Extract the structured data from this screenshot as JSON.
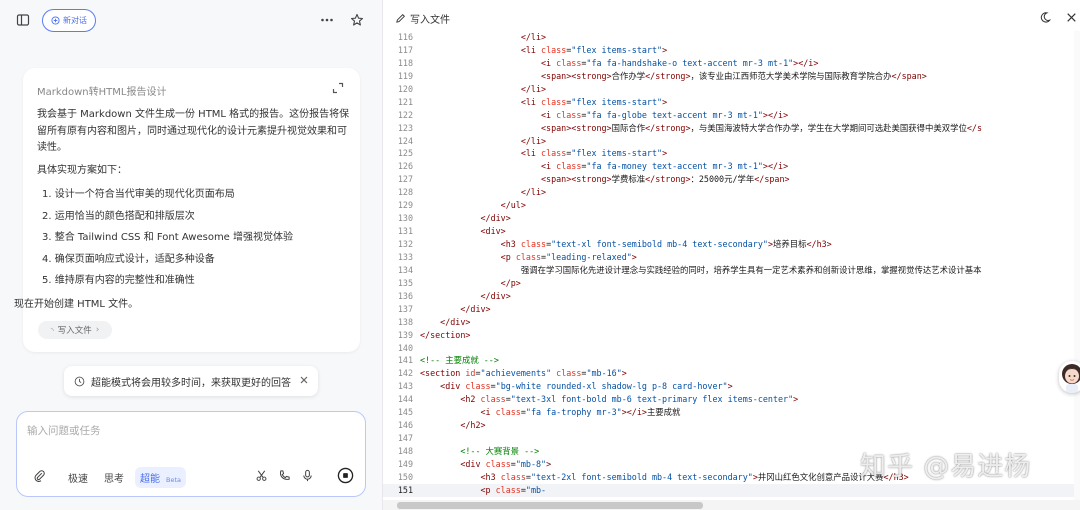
{
  "left": {
    "new_chat_label": "新对话",
    "card": {
      "title": "Markdown转HTML报告设计",
      "intro": "我会基于 Markdown 文件生成一份 HTML 格式的报告。这份报告将保留所有原有内容和图片，同时通过现代化的设计元素提升视觉效果和可读性。",
      "sub": "具体实现方案如下：",
      "steps": [
        "1. 设计一个符合当代审美的现代化页面布局",
        "2. 运用恰当的颜色搭配和排版层次",
        "3. 整合 Tailwind CSS 和 Font Awesome 增强视觉体验",
        "4. 确保页面响应式设计，适配多种设备",
        "5. 维持原有内容的完整性和准确性"
      ],
      "outro": "现在开始创建 HTML 文件。",
      "chip": "写入文件"
    },
    "notice": "超能模式将会用较多时间，来获取更好的回答",
    "input": {
      "placeholder": "输入问题或任务",
      "modes": [
        "极速",
        "思考",
        "超能"
      ],
      "beta": "Beta"
    }
  },
  "editor": {
    "title": "写入文件",
    "current_line": 151,
    "lines": [
      {
        "n": 116,
        "html": "<span class=\"t-tag\">                    &lt;/li&gt;</span>"
      },
      {
        "n": 117,
        "html": "<span class=\"t-tag\">                    &lt;li</span> <span class=\"t-attr\">class</span>=<span class=\"t-val\">\"flex items-start\"</span><span class=\"t-tag\">&gt;</span>"
      },
      {
        "n": 118,
        "html": "<span class=\"t-tag\">                        &lt;i</span> <span class=\"t-attr\">class</span>=<span class=\"t-val\">\"fa fa-handshake-o text-accent mr-3 mt-1\"</span><span class=\"t-tag\">&gt;&lt;/i&gt;</span>"
      },
      {
        "n": 119,
        "html": "<span class=\"t-tag\">                        &lt;span&gt;&lt;strong&gt;</span>合作办学<span class=\"t-tag\">&lt;/strong&gt;</span>，该专业由江西师范大学美术学院与国际教育学院合办<span class=\"t-tag\">&lt;/span&gt;</span>"
      },
      {
        "n": 120,
        "html": "<span class=\"t-tag\">                    &lt;/li&gt;</span>"
      },
      {
        "n": 121,
        "html": "<span class=\"t-tag\">                    &lt;li</span> <span class=\"t-attr\">class</span>=<span class=\"t-val\">\"flex items-start\"</span><span class=\"t-tag\">&gt;</span>"
      },
      {
        "n": 122,
        "html": "<span class=\"t-tag\">                        &lt;i</span> <span class=\"t-attr\">class</span>=<span class=\"t-val\">\"fa fa-globe text-accent mr-3 mt-1\"</span><span class=\"t-tag\">&gt;&lt;/i&gt;</span>"
      },
      {
        "n": 123,
        "html": "<span class=\"t-tag\">                        &lt;span&gt;&lt;strong&gt;</span>国际合作<span class=\"t-tag\">&lt;/strong&gt;</span>，与美国海波特大学合作办学，学生在大学期间可选赴美国获得中美双学位<span class=\"t-tag\">&lt;/s</span>"
      },
      {
        "n": 124,
        "html": "<span class=\"t-tag\">                    &lt;/li&gt;</span>"
      },
      {
        "n": 125,
        "html": "<span class=\"t-tag\">                    &lt;li</span> <span class=\"t-attr\">class</span>=<span class=\"t-val\">\"flex items-start\"</span><span class=\"t-tag\">&gt;</span>"
      },
      {
        "n": 126,
        "html": "<span class=\"t-tag\">                        &lt;i</span> <span class=\"t-attr\">class</span>=<span class=\"t-val\">\"fa fa-money text-accent mr-3 mt-1\"</span><span class=\"t-tag\">&gt;&lt;/i&gt;</span>"
      },
      {
        "n": 127,
        "html": "<span class=\"t-tag\">                        &lt;span&gt;&lt;strong&gt;</span>学费标准<span class=\"t-tag\">&lt;/strong&gt;</span>：25000元/学年<span class=\"t-tag\">&lt;/span&gt;</span>"
      },
      {
        "n": 128,
        "html": "<span class=\"t-tag\">                    &lt;/li&gt;</span>"
      },
      {
        "n": 129,
        "html": "<span class=\"t-tag\">                &lt;/ul&gt;</span>"
      },
      {
        "n": 130,
        "html": "<span class=\"t-tag\">            &lt;/div&gt;</span>"
      },
      {
        "n": 131,
        "html": "<span class=\"t-tag\">            &lt;div&gt;</span>"
      },
      {
        "n": 132,
        "html": "<span class=\"t-tag\">                &lt;h3</span> <span class=\"t-attr\">class</span>=<span class=\"t-val\">\"text-xl font-semibold mb-4 text-secondary\"</span><span class=\"t-tag\">&gt;</span>培养目标<span class=\"t-tag\">&lt;/h3&gt;</span>"
      },
      {
        "n": 133,
        "html": "<span class=\"t-tag\">                &lt;p</span> <span class=\"t-attr\">class</span>=<span class=\"t-val\">\"leading-relaxed\"</span><span class=\"t-tag\">&gt;</span>"
      },
      {
        "n": 134,
        "html": "                    强调在学习国际化先进设计理念与实践经验的同时，培养学生具有一定艺术素养和创新设计思维，掌握视觉传达艺术设计基本"
      },
      {
        "n": 135,
        "html": "<span class=\"t-tag\">                &lt;/p&gt;</span>"
      },
      {
        "n": 136,
        "html": "<span class=\"t-tag\">            &lt;/div&gt;</span>"
      },
      {
        "n": 137,
        "html": "<span class=\"t-tag\">        &lt;/div&gt;</span>"
      },
      {
        "n": 138,
        "html": "<span class=\"t-tag\">    &lt;/div&gt;</span>"
      },
      {
        "n": 139,
        "html": "<span class=\"t-tag\">&lt;/section&gt;</span>"
      },
      {
        "n": 140,
        "html": ""
      },
      {
        "n": 141,
        "html": "<span class=\"t-cmt\">&lt;!-- 主要成就 --&gt;</span>"
      },
      {
        "n": 142,
        "html": "<span class=\"t-tag\">&lt;section</span> <span class=\"t-attr\">id</span>=<span class=\"t-val\">\"achievements\"</span> <span class=\"t-attr\">class</span>=<span class=\"t-val\">\"mb-16\"</span><span class=\"t-tag\">&gt;</span>"
      },
      {
        "n": 143,
        "html": "<span class=\"t-tag\">    &lt;div</span> <span class=\"t-attr\">class</span>=<span class=\"t-val\">\"bg-white rounded-xl shadow-lg p-8 card-hover\"</span><span class=\"t-tag\">&gt;</span>"
      },
      {
        "n": 144,
        "html": "<span class=\"t-tag\">        &lt;h2</span> <span class=\"t-attr\">class</span>=<span class=\"t-val\">\"text-3xl font-bold mb-6 text-primary flex items-center\"</span><span class=\"t-tag\">&gt;</span>"
      },
      {
        "n": 145,
        "html": "<span class=\"t-tag\">            &lt;i</span> <span class=\"t-attr\">class</span>=<span class=\"t-val\">\"fa fa-trophy mr-3\"</span><span class=\"t-tag\">&gt;&lt;/i&gt;</span>主要成就"
      },
      {
        "n": 146,
        "html": "<span class=\"t-tag\">        &lt;/h2&gt;</span>"
      },
      {
        "n": 147,
        "html": ""
      },
      {
        "n": 148,
        "html": "<span class=\"t-cmt\">        &lt;!-- 大赛背景 --&gt;</span>"
      },
      {
        "n": 149,
        "html": "<span class=\"t-tag\">        &lt;div</span> <span class=\"t-attr\">class</span>=<span class=\"t-val\">\"mb-8\"</span><span class=\"t-tag\">&gt;</span>"
      },
      {
        "n": 150,
        "html": "<span class=\"t-tag\">            &lt;h3</span> <span class=\"t-attr\">class</span>=<span class=\"t-val\">\"text-2xl font-semibold mb-4 text-secondary\"</span><span class=\"t-tag\">&gt;</span>井冈山红色文化创意产品设计大赛<span class=\"t-tag\">&lt;/h3&gt;</span>"
      },
      {
        "n": 151,
        "html": "<span class=\"t-tag\">            &lt;p</span> <span class=\"t-attr\">class</span>=<span class=\"t-val\">\"mb-</span>"
      }
    ]
  },
  "watermark": "知乎 @易进杨"
}
